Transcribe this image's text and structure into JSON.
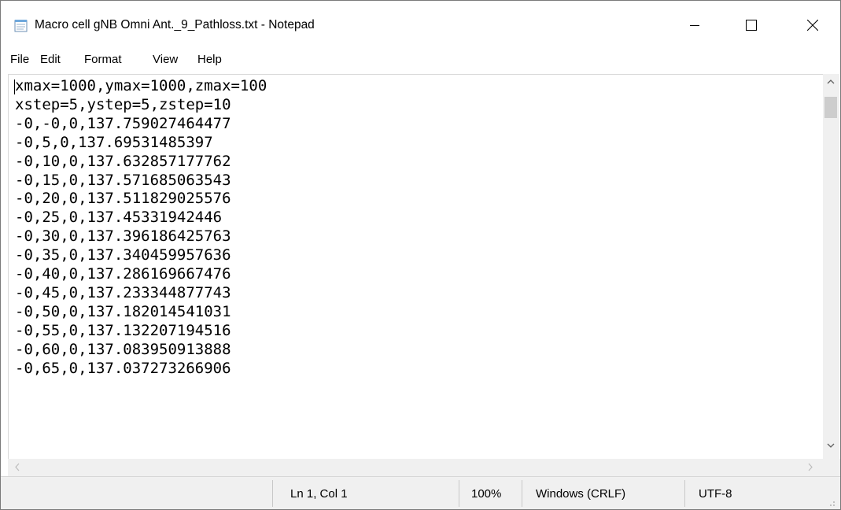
{
  "window": {
    "title": "Macro cell gNB Omni Ant._9_Pathloss.txt - Notepad",
    "icon": "notepad-icon",
    "controls": [
      "minimize-icon",
      "maximize-icon",
      "close-icon"
    ]
  },
  "menu": {
    "file": "File",
    "edit": "Edit",
    "format": "Format",
    "view": "View",
    "help": "Help"
  },
  "content": {
    "lines": [
      "xmax=1000,ymax=1000,zmax=100",
      "xstep=5,ystep=5,zstep=10",
      "-0,-0,0,137.759027464477",
      "-0,5,0,137.69531485397",
      "-0,10,0,137.632857177762",
      "-0,15,0,137.571685063543",
      "-0,20,0,137.511829025576",
      "-0,25,0,137.45331942446",
      "-0,30,0,137.396186425763",
      "-0,35,0,137.340459957636",
      "-0,40,0,137.286169667476",
      "-0,45,0,137.233344877743",
      "-0,50,0,137.182014541031",
      "-0,55,0,137.132207194516",
      "-0,60,0,137.083950913888",
      "-0,65,0,137.037273266906"
    ]
  },
  "status": {
    "position": "Ln 1, Col 1",
    "zoom": "100%",
    "line_ending": "Windows (CRLF)",
    "encoding": "UTF-8"
  },
  "colors": {
    "chrome": "#f0f0f0",
    "scroll_thumb": "#cdcdcd",
    "text": "#000000"
  }
}
